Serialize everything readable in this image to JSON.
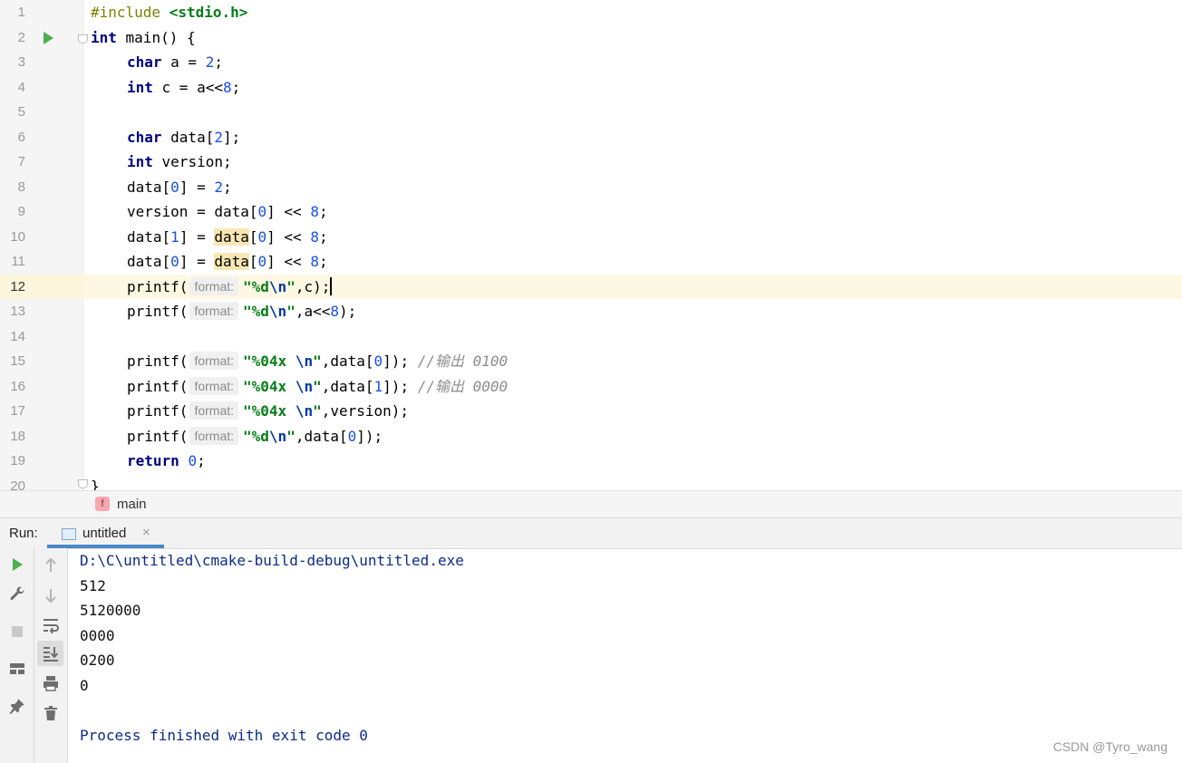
{
  "editor": {
    "line_numbers": [
      "1",
      "2",
      "3",
      "4",
      "5",
      "6",
      "7",
      "8",
      "9",
      "10",
      "11",
      "12",
      "13",
      "14",
      "15",
      "16",
      "17",
      "18",
      "19",
      "20"
    ],
    "current_line": "12",
    "hint_label": "format:",
    "lines": {
      "l1_pp": "#include ",
      "l1_inc": "<stdio.h>",
      "l2_kw": "int",
      "l2_rest": " main() {",
      "l3_kw": "char",
      "l3_a": " a = ",
      "l3_n": "2",
      "l3_end": ";",
      "l4_kw": "int",
      "l4_a": " c = a<<",
      "l4_n": "8",
      "l4_end": ";",
      "l6_kw": "char",
      "l6_a": " data[",
      "l6_n": "2",
      "l6_end": "];",
      "l7_kw": "int",
      "l7_a": " version;",
      "l8_a": "data[",
      "l8_n1": "0",
      "l8_b": "] = ",
      "l8_n2": "2",
      "l8_end": ";",
      "l9_a": "version = data[",
      "l9_n1": "0",
      "l9_b": "] << ",
      "l9_n2": "8",
      "l9_end": ";",
      "l10_a": "data[",
      "l10_n1": "1",
      "l10_b": "] = ",
      "l10_hl": "data",
      "l10_c": "[",
      "l10_n2": "0",
      "l10_d": "] << ",
      "l10_n3": "8",
      "l10_end": ";",
      "l11_a": "data[",
      "l11_n1": "0",
      "l11_b": "] = ",
      "l11_hl": "data",
      "l11_c": "[",
      "l11_n2": "0",
      "l11_d": "] << ",
      "l11_n3": "8",
      "l11_end": ";",
      "printf": "printf(",
      "q": "\"",
      "fmt_d": "%d",
      "fmt_04x": "%04x ",
      "esc_n": "\\n",
      "l12_rest": ",c);",
      "l13_rest": ",a<<",
      "l13_n": "8",
      "l13_end": ");",
      "l15_a": ",data[",
      "l15_n": "0",
      "l15_end": "]); ",
      "l15_cmt": "//输出 0100",
      "l16_a": ",data[",
      "l16_n": "1",
      "l16_end": "]); ",
      "l16_cmt": "//输出 0000",
      "l17_rest": ",version);",
      "l18_a": ",data[",
      "l18_n": "0",
      "l18_end": "]);",
      "l19_kw": "return",
      "l19_sp": " ",
      "l19_n": "0",
      "l19_end": ";",
      "l20": "}"
    }
  },
  "breadcrumb": {
    "icon_letter": "f",
    "label": "main"
  },
  "run_panel": {
    "label": "Run:",
    "tab_title": "untitled",
    "tab_close": "×",
    "console_lines": [
      "D:\\C\\untitled\\cmake-build-debug\\untitled.exe",
      "512",
      "5120000",
      "0000",
      "0200",
      "0",
      "",
      "Process finished with exit code 0"
    ],
    "toolbar_icons": [
      "run-icon",
      "wrench-icon",
      "stop-icon",
      "layout-icon",
      "pin-icon",
      "up-arrow-icon",
      "down-arrow-icon",
      "soft-wrap-icon",
      "scroll-to-end-icon",
      "print-icon",
      "trash-icon"
    ]
  },
  "watermark": "CSDN @Tyro_wang",
  "colors": {
    "keyword": "#000080",
    "number": "#1750eb",
    "string": "#067d17",
    "comment": "#8c8c8c",
    "current_line": "#fdf8e3",
    "tab_underline": "#4a88c7"
  }
}
